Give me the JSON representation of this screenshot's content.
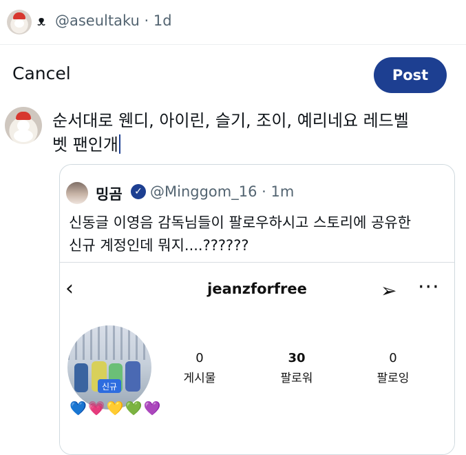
{
  "topbar": {
    "symbol": "ᴥ",
    "handle": "@aseultaku · 1d"
  },
  "compose": {
    "cancel_label": "Cancel",
    "post_label": "Post",
    "text": "순서대로 웬디, 아이린, 슬기, 조이, 예리네요 레드벨\n벳 팬인개"
  },
  "quote": {
    "name": "밍곰",
    "handle": "@Minggom_16 · 1m",
    "text": "신동글 이영음 감독님들이 팔로우하시고 스토리에 공유한\n신규 계정인데 뭐지....??????"
  },
  "instagram": {
    "back_icon": "‹",
    "username": "jeanzforfree",
    "send_icon": "➢",
    "more_icon": "···",
    "new_badge": "신규",
    "stats": [
      {
        "value": "0",
        "label": "게시물"
      },
      {
        "value": "30",
        "label": "팔로워"
      },
      {
        "value": "0",
        "label": "팔로잉"
      }
    ],
    "hearts": "💙💗💛💚💜"
  }
}
